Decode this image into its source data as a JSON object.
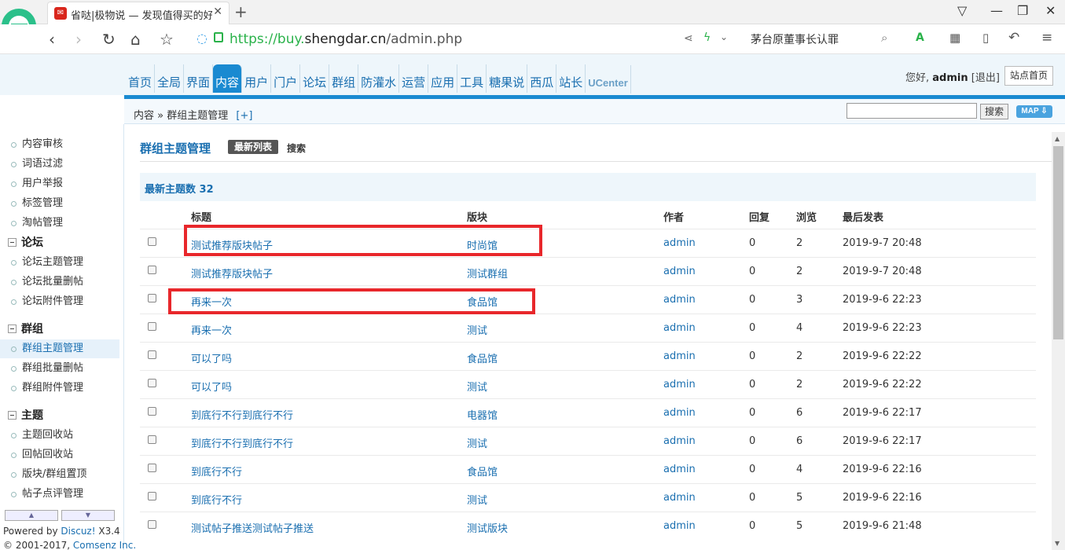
{
  "browser": {
    "tab_title": "省哒|极物说 — 发现值得买的好东西",
    "url_host": "https://buy.",
    "url_domain": "shengdar.cn",
    "url_path": "/admin.php",
    "search_text": "茅台原董事长认罪"
  },
  "header": {
    "nav": [
      "首页",
      "全局",
      "界面",
      "内容",
      "用户",
      "门户",
      "论坛",
      "群组",
      "防灌水",
      "运营",
      "应用",
      "工具",
      "糖果说",
      "西瓜",
      "站长",
      "UCenter"
    ],
    "active_nav": "内容",
    "greeting": "您好,",
    "username": "admin",
    "logout": "[退出]",
    "site_home": "站点首页"
  },
  "breadcrumb": {
    "root": "内容",
    "sep": "»",
    "current": "群组主题管理",
    "plus": "[+]",
    "search_button": "搜索",
    "map_button": "MAP"
  },
  "sidebar": {
    "top_items": [
      "内容审核",
      "词语过滤",
      "用户举报",
      "标签管理",
      "淘帖管理"
    ],
    "groups": [
      {
        "title": "论坛",
        "items": [
          "论坛主题管理",
          "论坛批量删帖",
          "论坛附件管理"
        ]
      },
      {
        "title": "群组",
        "items": [
          "群组主题管理",
          "群组批量删帖",
          "群组附件管理"
        ]
      },
      {
        "title": "主题",
        "items": [
          "主题回收站",
          "回帖回收站",
          "版块/群组置顶",
          "帖子点评管理"
        ]
      }
    ],
    "active_item": "群组主题管理",
    "powered_by": "Powered by",
    "powered_link": "Discuz!",
    "version": "X3.4",
    "copyright": "© 2001-2017,",
    "copyright_link": "Comsenz Inc."
  },
  "main": {
    "title": "群组主题管理",
    "tab_latest": "最新列表",
    "tab_search": "搜索",
    "count_label": "最新主题数",
    "count_value": "32",
    "columns": [
      "标题",
      "版块",
      "作者",
      "回复",
      "浏览",
      "最后发表"
    ],
    "rows": [
      {
        "title": "测试推荐版块帖子",
        "forum": "时尚馆",
        "author": "admin",
        "replies": "0",
        "views": "2",
        "last": "2019-9-7 20:48"
      },
      {
        "title": "测试推荐版块帖子",
        "forum": "测试群组",
        "author": "admin",
        "replies": "0",
        "views": "2",
        "last": "2019-9-7 20:48"
      },
      {
        "title": "再来一次",
        "forum": "食品馆",
        "author": "admin",
        "replies": "0",
        "views": "3",
        "last": "2019-9-6 22:23"
      },
      {
        "title": "再来一次",
        "forum": "测试",
        "author": "admin",
        "replies": "0",
        "views": "4",
        "last": "2019-9-6 22:23"
      },
      {
        "title": "可以了吗",
        "forum": "食品馆",
        "author": "admin",
        "replies": "0",
        "views": "2",
        "last": "2019-9-6 22:22"
      },
      {
        "title": "可以了吗",
        "forum": "测试",
        "author": "admin",
        "replies": "0",
        "views": "2",
        "last": "2019-9-6 22:22"
      },
      {
        "title": "到底行不行到底行不行",
        "forum": "电器馆",
        "author": "admin",
        "replies": "0",
        "views": "6",
        "last": "2019-9-6 22:17"
      },
      {
        "title": "到底行不行到底行不行",
        "forum": "测试",
        "author": "admin",
        "replies": "0",
        "views": "6",
        "last": "2019-9-6 22:17"
      },
      {
        "title": "到底行不行",
        "forum": "食品馆",
        "author": "admin",
        "replies": "0",
        "views": "4",
        "last": "2019-9-6 22:16"
      },
      {
        "title": "到底行不行",
        "forum": "测试",
        "author": "admin",
        "replies": "0",
        "views": "5",
        "last": "2019-9-6 22:16"
      },
      {
        "title": "测试帖子推送测试帖子推送",
        "forum": "测试版块",
        "author": "admin",
        "replies": "0",
        "views": "5",
        "last": "2019-9-6 21:48"
      }
    ]
  },
  "colors": {
    "accent": "#1a8ad1",
    "link": "#1a6fb0",
    "highlight": "#e8272b"
  }
}
